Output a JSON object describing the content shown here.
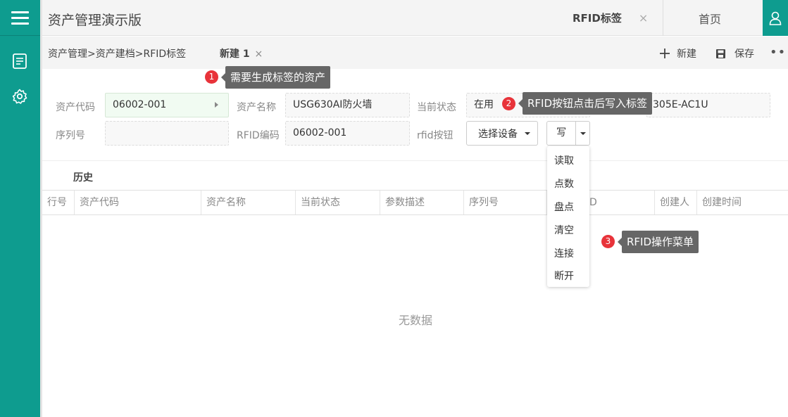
{
  "header": {
    "app_title": "资产管理演示版",
    "tabs": [
      {
        "label": "RFID标签",
        "close": "×"
      },
      {
        "label": "首页"
      }
    ]
  },
  "subbar": {
    "breadcrumb": "资产管理>资产建档>RFID标签",
    "active_tab": "新建 1",
    "active_tab_close": "×",
    "actions": {
      "new": "新建",
      "save": "保存",
      "more": "•••"
    }
  },
  "form": {
    "asset_code": {
      "label": "资产代码",
      "value": "06002-001"
    },
    "asset_name": {
      "label": "资产名称",
      "value": "USG630AI防火墙"
    },
    "status": {
      "label": "当前状态",
      "value": "在用"
    },
    "param_partial": "305E-AC1U",
    "serial": {
      "label": "序列号",
      "value": ""
    },
    "rfid_code": {
      "label": "RFID编码",
      "value": "06002-001"
    },
    "rfid_button": {
      "label": "rfid按钮",
      "select_device": "选择设备",
      "write": "写"
    }
  },
  "history": {
    "title": "历史",
    "columns": [
      "行号",
      "资产代码",
      "资产名称",
      "当前状态",
      "参数描述",
      "序列号",
      "D",
      "创建人",
      "创建时间"
    ],
    "empty_text": "无数据"
  },
  "dropdown_menu": [
    "读取",
    "点数",
    "盘点",
    "清空",
    "连接",
    "断开"
  ],
  "annotations": [
    {
      "num": "1",
      "text": "需要生成标签的资产"
    },
    {
      "num": "2",
      "text": "RFID按钮点击后写入标签"
    },
    {
      "num": "3",
      "text": "RFID操作菜单"
    }
  ],
  "colors": {
    "primary": "#0e9c8f",
    "badge": "#e8333a",
    "callout": "#666666"
  }
}
